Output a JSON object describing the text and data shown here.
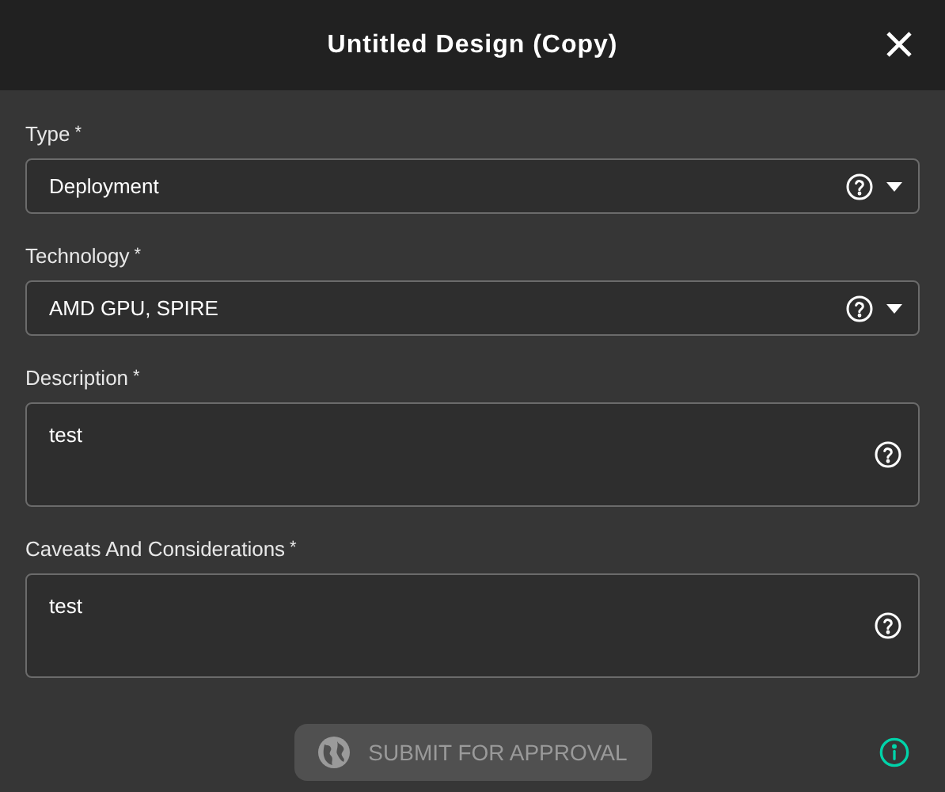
{
  "dialog": {
    "title": "Untitled Design (Copy)"
  },
  "fields": [
    {
      "kind": "select",
      "label": "Type",
      "required_mark": "*",
      "value": "Deployment"
    },
    {
      "kind": "select",
      "label": "Technology",
      "required_mark": "*",
      "value": "AMD GPU, SPIRE"
    },
    {
      "kind": "textarea",
      "label": "Description",
      "required_mark": "*",
      "value": "test"
    },
    {
      "kind": "textarea",
      "label": "Caveats And Considerations",
      "required_mark": "*",
      "value": "test"
    }
  ],
  "submit_button": {
    "label": "SUBMIT FOR APPROVAL",
    "disabled": true
  }
}
